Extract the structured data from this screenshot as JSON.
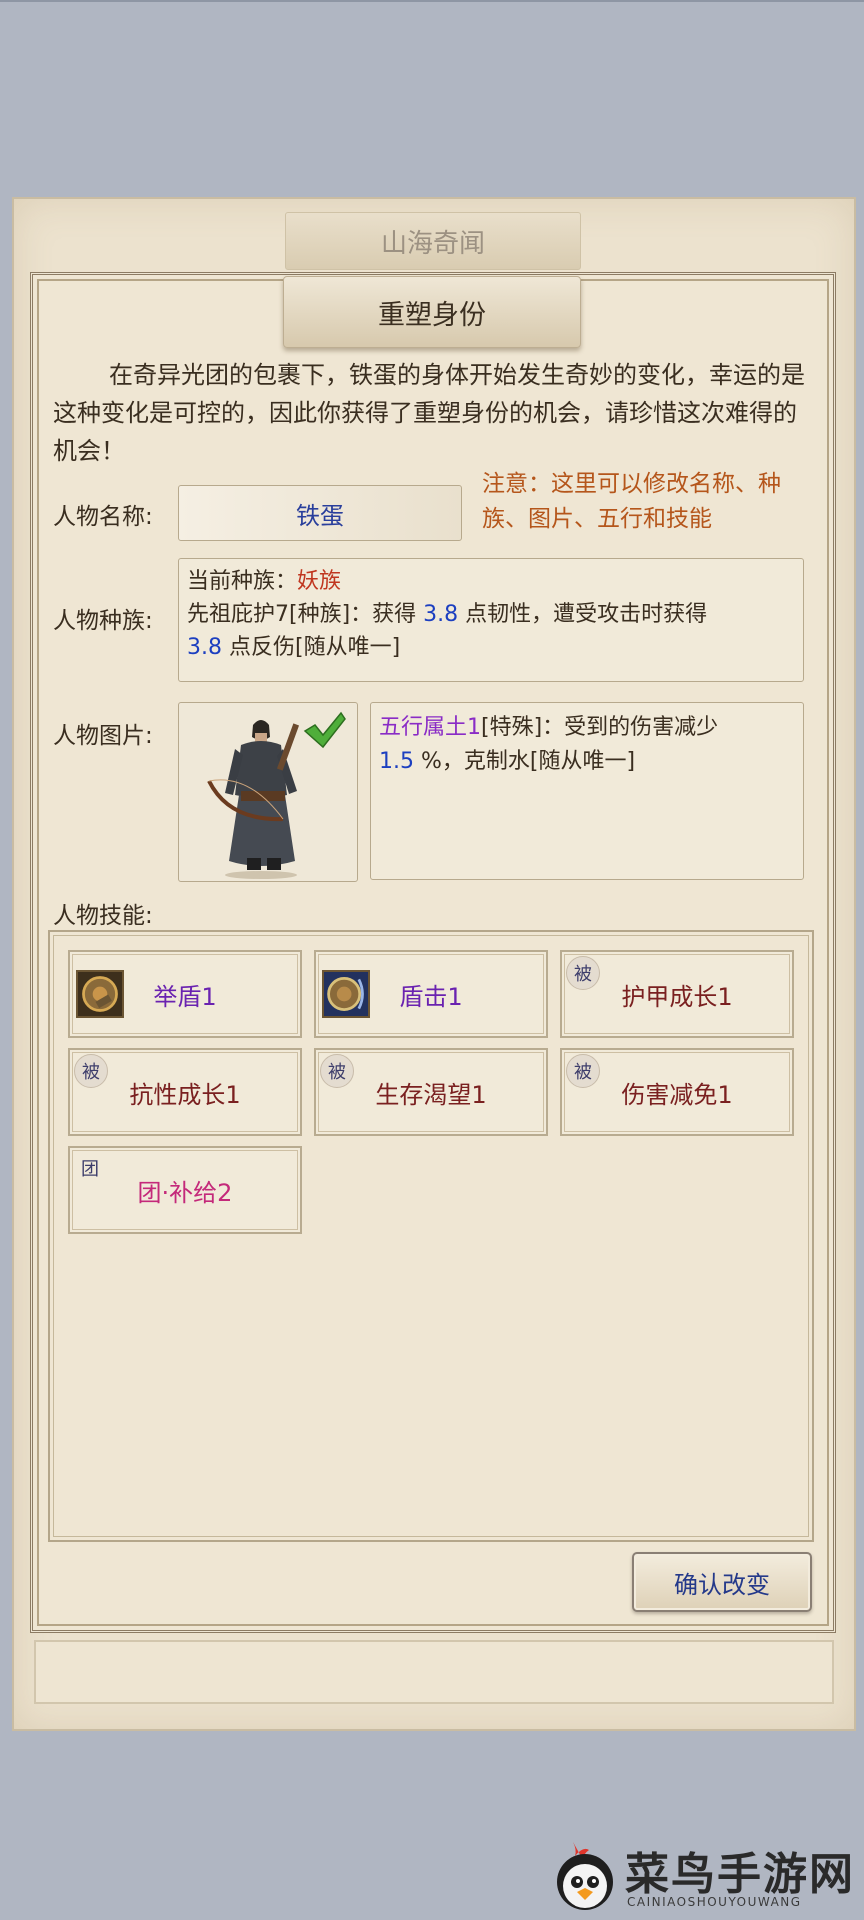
{
  "window": {
    "back_tab": "山海奇闻",
    "front_tab": "重塑身份"
  },
  "intro_text": "在奇异光团的包裹下，铁蛋的身体开始发生奇妙的变化，幸运的是这种变化是可控的，因此你获得了重塑身份的机会，请珍惜这次难得的机会！",
  "name_field": {
    "label": "人物名称:",
    "value": "铁蛋"
  },
  "notice": "注意：这里可以修改名称、种族、图片、五行和技能",
  "race": {
    "label": "人物种族:",
    "current_prefix": "当前种族：",
    "current_value": "妖族",
    "desc_1": "先祖庇护7[种族]：获得 ",
    "value_1": "3.8",
    "desc_2": " 点韧性，遭受攻击时获得",
    "value_2": "3.8",
    "desc_3": " 点反伤[随从唯一]"
  },
  "portrait": {
    "label": "人物图片:",
    "selected": true
  },
  "wuxing": {
    "name": "五行属土1",
    "desc_1": "[特殊]：受到的伤害减少",
    "value": "1.5",
    "desc_2": " %，克制水[随从唯一]"
  },
  "skills": {
    "label": "人物技能:",
    "items": [
      {
        "name": "举盾1",
        "type": "active",
        "icon": "shield-raise-icon"
      },
      {
        "name": "盾击1",
        "type": "active",
        "icon": "shield-bash-icon"
      },
      {
        "name": "护甲成长1",
        "type": "passive",
        "badge": "被"
      },
      {
        "name": "抗性成长1",
        "type": "passive",
        "badge": "被"
      },
      {
        "name": "生存渴望1",
        "type": "passive",
        "badge": "被"
      },
      {
        "name": "伤害减免1",
        "type": "passive",
        "badge": "被"
      },
      {
        "name": "团·补给2",
        "type": "team",
        "badge": "团"
      }
    ]
  },
  "confirm_button": "确认改变",
  "watermark": {
    "title": "菜鸟手游网",
    "subtitle": "CAINIAOSHOUYOUWANG"
  },
  "colors": {
    "background": "#b0b6c2",
    "parchment": "#efe6d3",
    "notice": "#b5561b",
    "link_blue": "#1c3fc0"
  }
}
